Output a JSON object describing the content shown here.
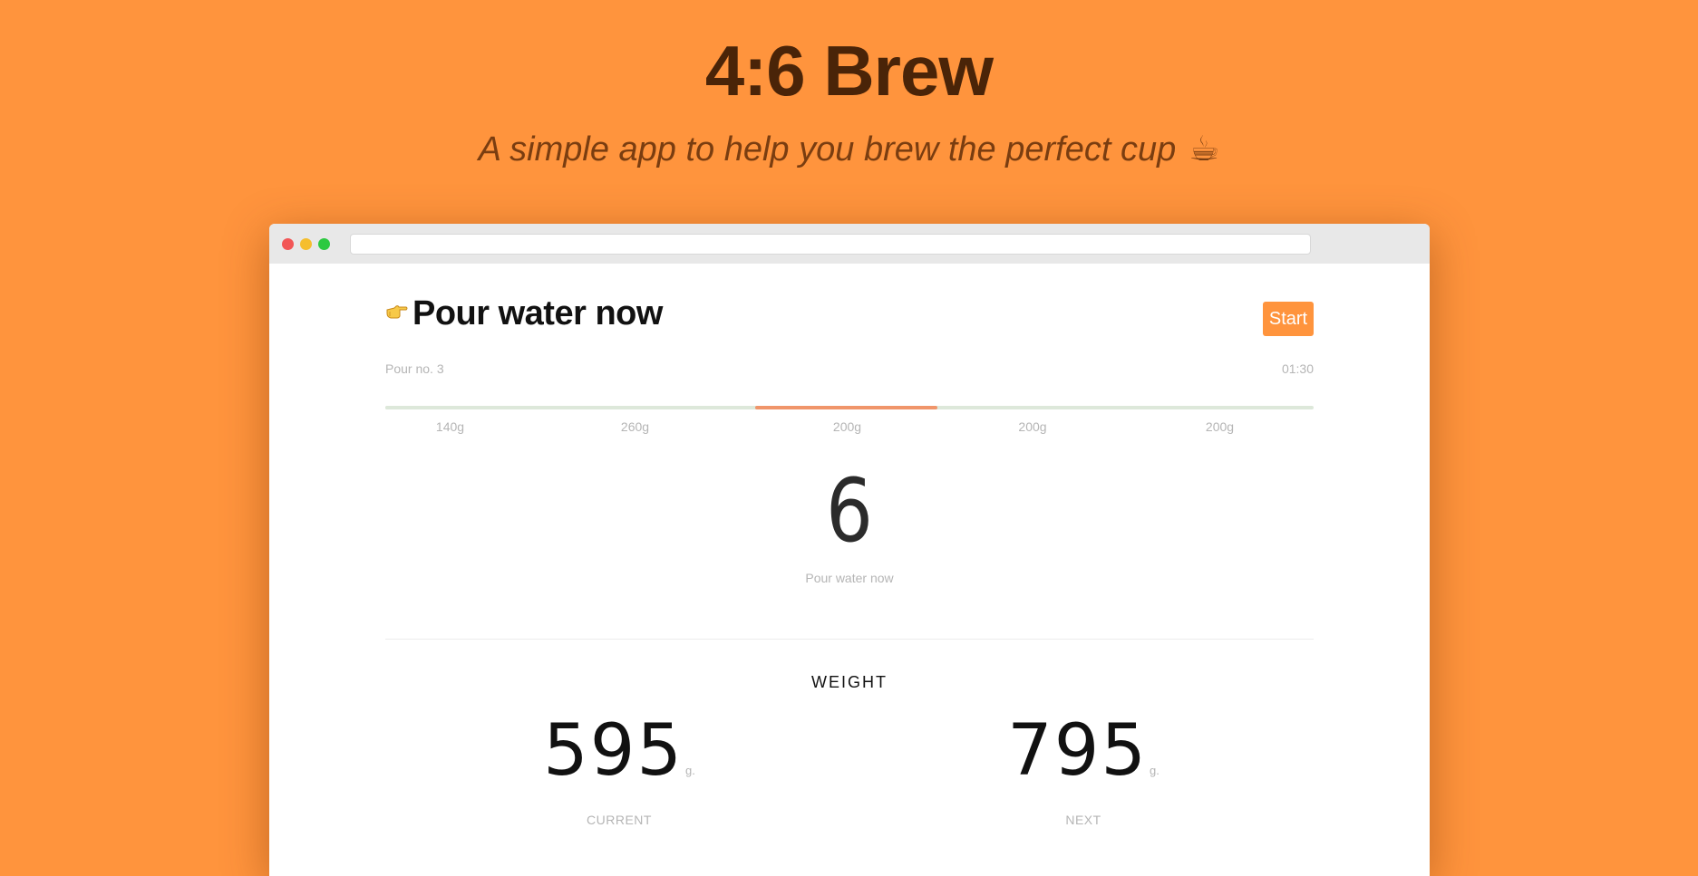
{
  "hero": {
    "title": "4:6 Brew",
    "subtitle": "A simple app to help you brew the perfect cup",
    "subtitle_icon": "☕"
  },
  "app": {
    "heading": "Pour water now",
    "heading_icon": "pointing-hand-icon",
    "start_label": "Start",
    "pour_label": "Pour no. 3",
    "timer": "01:30",
    "segments": [
      {
        "label": "140g",
        "status": "done"
      },
      {
        "label": "260g",
        "status": "done"
      },
      {
        "label": "200g",
        "status": "active"
      },
      {
        "label": "200g",
        "status": "pending"
      },
      {
        "label": "200g",
        "status": "pending"
      }
    ],
    "countdown": "6",
    "countdown_caption": "Pour water now",
    "weight": {
      "heading": "WEIGHT",
      "current_value": "595",
      "current_unit": "g.",
      "current_caption": "CURRENT",
      "next_value": "795",
      "next_unit": "g.",
      "next_caption": "NEXT"
    }
  },
  "colors": {
    "background": "#FF943D",
    "accent": "#FF943D",
    "active_segment": "#F0956A",
    "track": "#DDE8DA"
  }
}
